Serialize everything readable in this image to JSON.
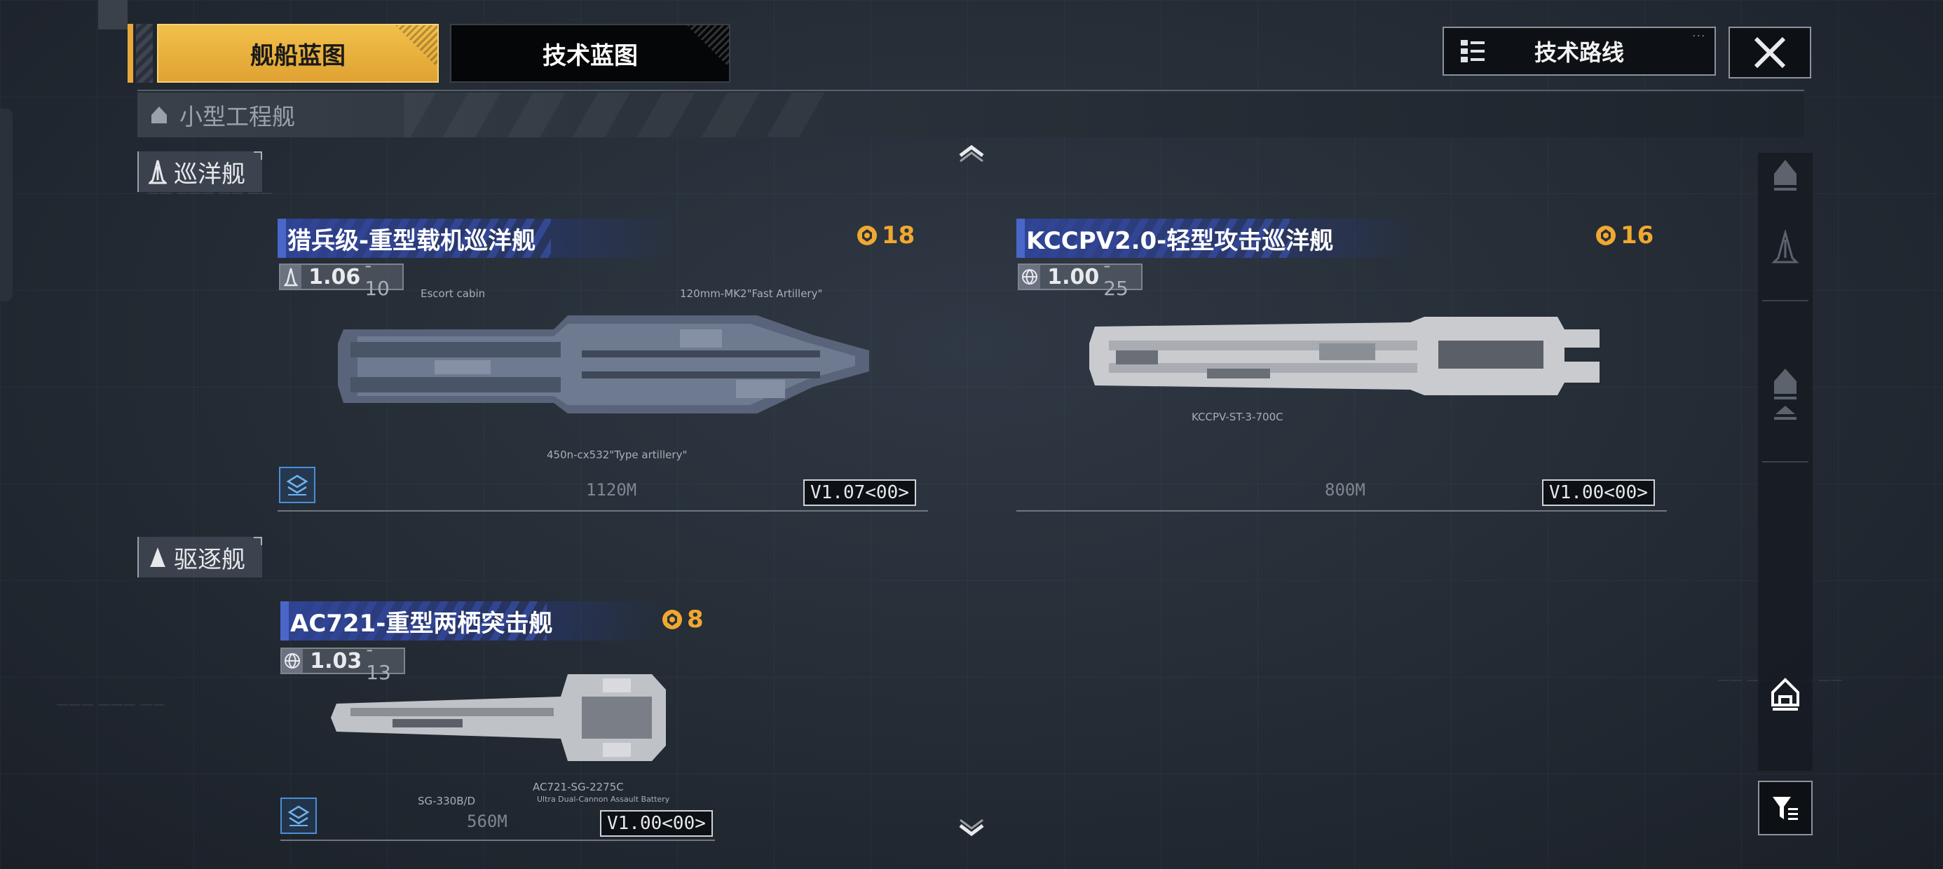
{
  "tabs": {
    "ship_blueprint": "舰船蓝图",
    "tech_blueprint": "技术蓝图"
  },
  "tech_route": {
    "label": "技术路线"
  },
  "category": {
    "label": "小型工程舰"
  },
  "sections": {
    "cruiser": "巡洋舰",
    "destroyer": "驱逐舰"
  },
  "ships": [
    {
      "name": "猎兵级-重型载机巡洋舰",
      "points": "18",
      "version_main": "1.06",
      "version_sub": "- 10",
      "blueprint_version": "V1.07<00>",
      "length": "1120M",
      "annotations": [
        "Escort cabin",
        "120mm-MK2\"Fast Artillery\"",
        "450n-cx532\"Type artillery\""
      ]
    },
    {
      "name": "KCCPV2.0-轻型攻击巡洋舰",
      "points": "16",
      "version_main": "1.00",
      "version_sub": "- 25",
      "blueprint_version": "V1.00<00>",
      "length": "800M",
      "annotations": [
        "KCCPV-ST-3-700C"
      ]
    },
    {
      "name": "AC721-重型两栖突击舰",
      "points": "8",
      "version_main": "1.03",
      "version_sub": "- 13",
      "blueprint_version": "V1.00<00>",
      "length": "560M",
      "annotations": [
        "SG-330B/D",
        "AC721-SG-2275C",
        "Ultra Dual-Cannon Assault Battery"
      ]
    }
  ],
  "colors": {
    "accent_gold": "#e9a93a",
    "points_orange": "#f0a830",
    "title_blue": "#3048a0"
  }
}
